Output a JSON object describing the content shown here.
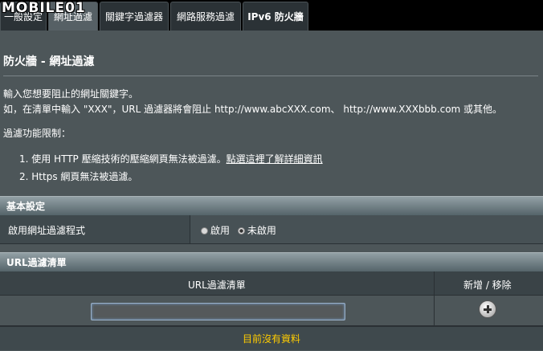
{
  "watermark": "MOBILE01",
  "tabs": [
    {
      "label": "一般設定"
    },
    {
      "label": "網址過濾"
    },
    {
      "label": "關鍵字過濾器"
    },
    {
      "label": "網路服務過濾"
    },
    {
      "label": "IPv6 防火牆"
    }
  ],
  "page": {
    "title": "防火牆 - 網址過濾",
    "intro1": "輸入您想要阻止的網址關鍵字。",
    "intro2": "如，在清單中輸入 \"XXX\"，URL 過濾器將會阻止 http://www.abcXXX.com、 http://www.XXXbbb.com 或其他。",
    "limit_heading": "過濾功能限制：",
    "limit1_text": "1. 使用 HTTP 壓縮技術的壓縮網頁無法被過濾。",
    "limit1_link": "點選這裡了解詳細資訊",
    "limit2_text": "2. Https 網頁無法被過濾。"
  },
  "basic": {
    "header": "基本設定",
    "enable_label": "啟用網址過濾程式",
    "option_on": "啟用",
    "option_off": "未啟用",
    "selected": "未啟用"
  },
  "urllist": {
    "header": "URL過濾清單",
    "col_url": "URL過濾清單",
    "col_action": "新增 / 移除",
    "input_value": "",
    "empty_text": "目前沒有資料"
  }
}
